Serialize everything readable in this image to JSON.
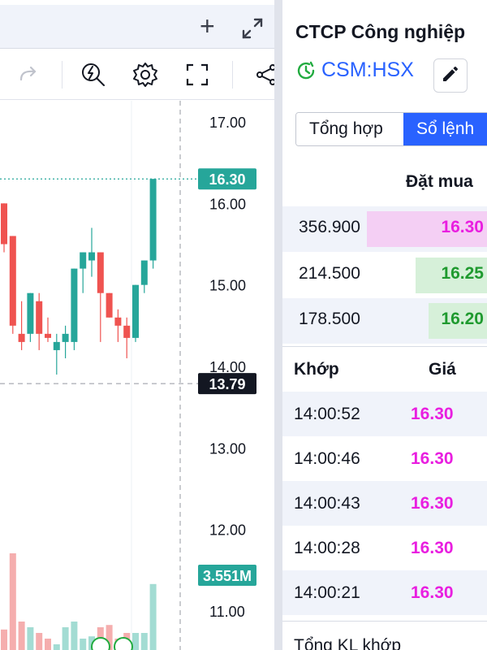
{
  "chart": {
    "price_axis": [
      "17.00",
      "16.00",
      "15.00",
      "14.00",
      "13.00",
      "12.00",
      "11.00"
    ],
    "last_price_tag": "16.30",
    "crosshair_tag": "13.79",
    "volume_tag": "3.551M",
    "colors": {
      "up": "#26a69a",
      "down": "#ef5350",
      "up_vol": "#a3dcd3",
      "down_vol": "#f5aeae",
      "price_tag_bg": "#26a69a",
      "crosshair_tag_bg": "#131722"
    },
    "icons": {
      "add": "plus-icon",
      "expand": "expand-icon",
      "redo": "redo-arrow-icon",
      "indicators": "lightning-magnifier-icon",
      "settings": "gear-icon",
      "fullscreen": "fullscreen-icon",
      "share": "share-icon"
    }
  },
  "chart_data": {
    "type": "candlestick",
    "ylim": [
      10.6,
      17.2
    ],
    "candles": [
      {
        "o": 16.0,
        "h": 16.0,
        "l": 15.4,
        "c": 15.5
      },
      {
        "o": 15.6,
        "h": 15.6,
        "l": 14.4,
        "c": 14.5
      },
      {
        "o": 14.4,
        "h": 14.8,
        "l": 14.2,
        "c": 14.3
      },
      {
        "o": 14.4,
        "h": 14.9,
        "l": 14.3,
        "c": 14.9
      },
      {
        "o": 14.8,
        "h": 14.9,
        "l": 14.2,
        "c": 14.4
      },
      {
        "o": 14.4,
        "h": 14.6,
        "l": 14.3,
        "c": 14.35
      },
      {
        "o": 14.2,
        "h": 14.4,
        "l": 13.9,
        "c": 14.3
      },
      {
        "o": 14.3,
        "h": 14.5,
        "l": 14.1,
        "c": 14.4
      },
      {
        "o": 14.3,
        "h": 15.2,
        "l": 14.2,
        "c": 15.2
      },
      {
        "o": 15.2,
        "h": 15.4,
        "l": 14.9,
        "c": 15.4
      },
      {
        "o": 15.3,
        "h": 15.7,
        "l": 15.1,
        "c": 15.4
      },
      {
        "o": 15.4,
        "h": 15.4,
        "l": 14.3,
        "c": 14.9
      },
      {
        "o": 14.9,
        "h": 14.9,
        "l": 14.6,
        "c": 14.6
      },
      {
        "o": 14.6,
        "h": 14.7,
        "l": 14.3,
        "c": 14.5
      },
      {
        "o": 14.5,
        "h": 14.6,
        "l": 14.1,
        "c": 14.35
      },
      {
        "o": 14.35,
        "h": 15.0,
        "l": 14.3,
        "c": 15.0
      },
      {
        "o": 15.0,
        "h": 15.3,
        "l": 14.9,
        "c": 15.3
      },
      {
        "o": 15.3,
        "h": 16.3,
        "l": 15.2,
        "c": 16.3
      }
    ],
    "volume_ratio": [
      0.18,
      0.85,
      0.25,
      0.2,
      0.15,
      0.1,
      0.05,
      0.2,
      0.25,
      0.1,
      0.12,
      0.2,
      0.22,
      0.1,
      0.15,
      0.15,
      0.15,
      0.58
    ]
  },
  "side": {
    "company": "CTCP Công nghiệp",
    "ticker": "CSM:HSX",
    "tab_summary": "Tổng hợp",
    "tab_orderbook": "Sổ lệnh",
    "bid_header": "Đặt mua",
    "bids": [
      {
        "volume": "356.900",
        "price": "16.30",
        "bar_color": "#f4cff4",
        "price_color": "#e91ee0"
      },
      {
        "volume": "214.500",
        "price": "16.25",
        "bar_color": "#d6f0d9",
        "price_color": "#1f9a2f"
      },
      {
        "volume": "178.500",
        "price": "16.20",
        "bar_color": "#d6f0d9",
        "price_color": "#1f9a2f"
      }
    ],
    "match_header_time": "Khớp",
    "match_header_price": "Giá",
    "matches": [
      {
        "time": "14:00:52",
        "price": "16.30"
      },
      {
        "time": "14:00:46",
        "price": "16.30"
      },
      {
        "time": "14:00:43",
        "price": "16.30"
      },
      {
        "time": "14:00:28",
        "price": "16.30"
      },
      {
        "time": "14:00:21",
        "price": "16.30"
      }
    ],
    "total_label": "Tổng KL khớp"
  }
}
